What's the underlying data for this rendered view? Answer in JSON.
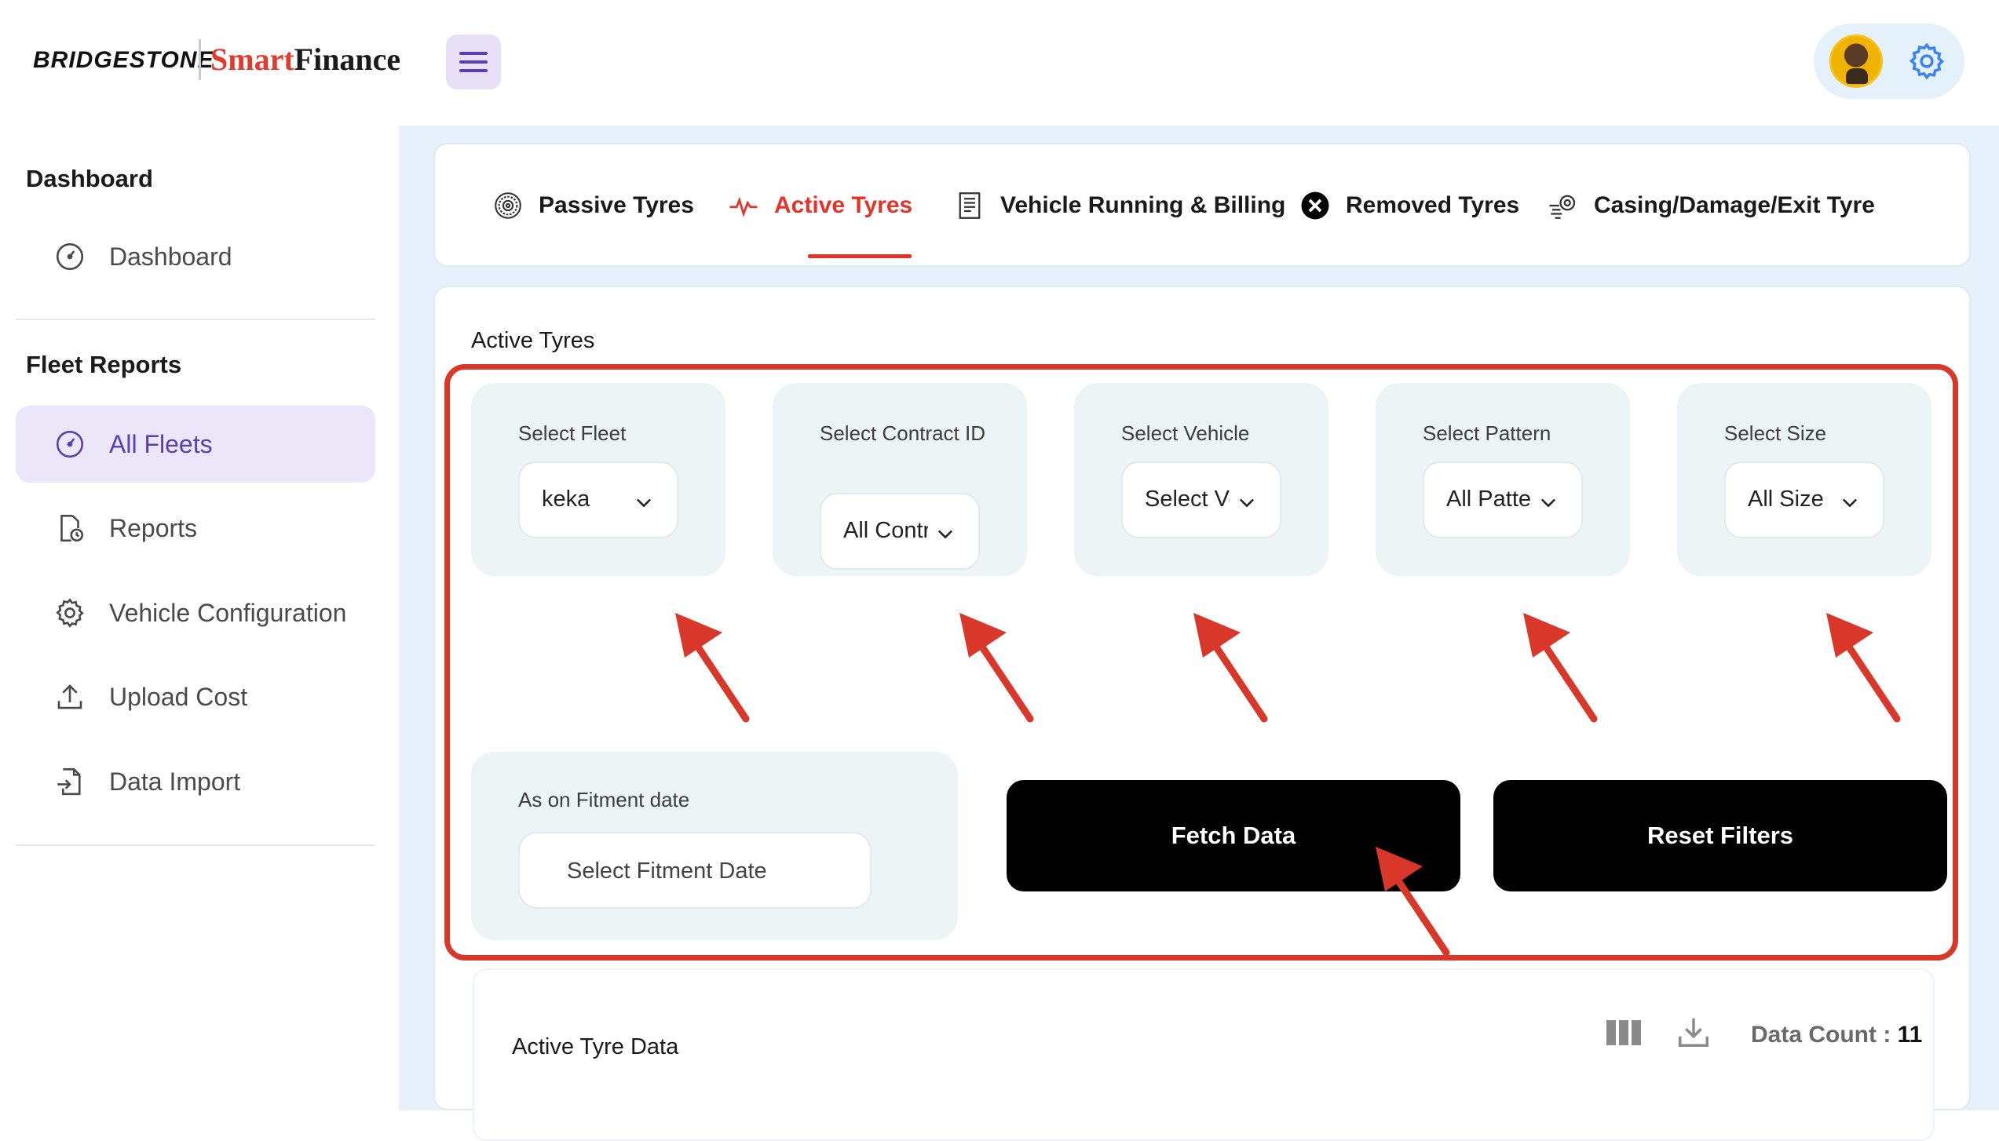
{
  "header": {
    "brand_left": "BRIDGESTONE",
    "brand_right_part1": "Smart",
    "brand_right_part2": "Finance"
  },
  "sidebar": {
    "section1_title": "Dashboard",
    "section1_items": [
      {
        "label": "Dashboard",
        "icon": "gauge-icon"
      }
    ],
    "section2_title": "Fleet Reports",
    "section2_items": [
      {
        "label": "All Fleets",
        "icon": "gauge-icon",
        "active": true
      },
      {
        "label": "Reports",
        "icon": "report-clock-icon"
      },
      {
        "label": "Vehicle Configuration",
        "icon": "gear-icon"
      },
      {
        "label": "Upload Cost",
        "icon": "upload-icon"
      },
      {
        "label": "Data Import",
        "icon": "file-import-icon"
      }
    ]
  },
  "tabs": [
    {
      "label": "Passive Tyres",
      "icon": "tyre-icon"
    },
    {
      "label": "Active Tyres",
      "icon": "pulse-icon",
      "active": true
    },
    {
      "label": "Vehicle Running & Billing",
      "icon": "bill-icon"
    },
    {
      "label": "Removed Tyres",
      "icon": "close-circle-icon"
    },
    {
      "label": "Casing/Damage/Exit Tyre",
      "icon": "tyre-wind-icon"
    }
  ],
  "main": {
    "section_title": "Active Tyres",
    "filters": [
      {
        "label": "Select Fleet",
        "value": "keka"
      },
      {
        "label": "Select Contract ID",
        "value": "All Contract ID"
      },
      {
        "label": "Select Vehicle",
        "value": "Select Vehicle"
      },
      {
        "label": "Select Pattern",
        "value": "All Pattern"
      },
      {
        "label": "Select Size",
        "value": "All Size"
      }
    ],
    "date_filter": {
      "label": "As on Fitment date",
      "placeholder": "Select Fitment Date"
    },
    "fetch_button": "Fetch Data",
    "reset_button": "Reset Filters",
    "data_section_title": "Active Tyre Data",
    "data_count_label": "Data Count : ",
    "data_count_value": "11"
  },
  "colors": {
    "accent_red": "#e5332a",
    "accent_purple": "#5a3fb3",
    "annotation_red": "#d8372a",
    "main_bg": "#e6f1fb"
  }
}
